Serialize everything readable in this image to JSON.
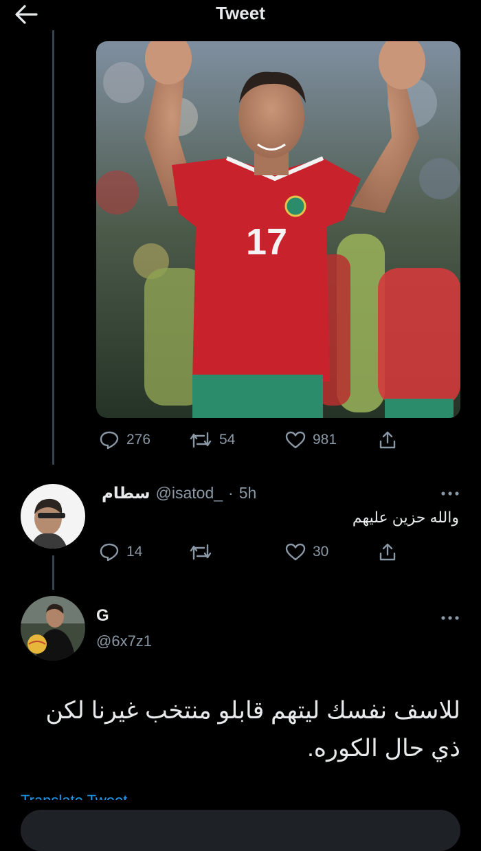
{
  "header": {
    "title": "Tweet",
    "back_icon": "arrow-left-icon"
  },
  "parent_tweet": {
    "image_alt": "Moroccan football player in red jersey number 17 waving to the crowd",
    "jersey_number": "17",
    "actions": {
      "replies": "276",
      "retweets": "54",
      "likes": "981"
    }
  },
  "reply_1": {
    "name": "سطام",
    "handle": "@isatod_",
    "separator": "·",
    "time": "5h",
    "text": "والله حزين عليهم",
    "actions": {
      "replies": "14",
      "retweets": "",
      "likes": "30"
    }
  },
  "reply_2": {
    "name": "G",
    "handle": "@6x7z1",
    "text": "للاسف نفسك ليتهم قابلو منتخب غيرنا لكن ذي حال الكوره.",
    "translate_label": "Translate Tweet"
  },
  "colors": {
    "background": "#000000",
    "muted": "#8b98a5",
    "accent": "#1d9bf0",
    "jersey_red": "#c8232c",
    "shorts_green": "#2a8c6b"
  }
}
